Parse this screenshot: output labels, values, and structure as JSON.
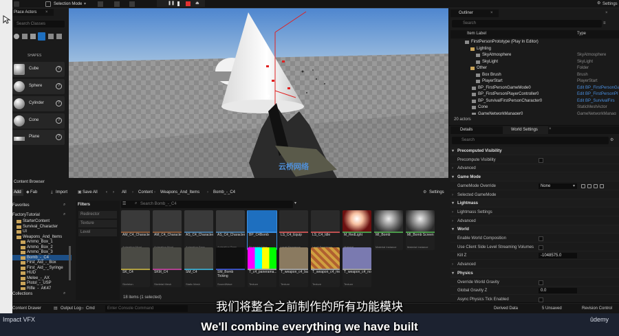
{
  "toolbar": {
    "mode": "Selection Mode",
    "settings": "Settings"
  },
  "place_actors": {
    "tab": "Place Actors",
    "search_placeholder": "Search Classes",
    "category": "SHAPES",
    "shapes": [
      "Cube",
      "Sphere",
      "Cylinder",
      "Cone",
      "Plane"
    ]
  },
  "viewport": {
    "watermark": "云桥网络"
  },
  "outliner": {
    "tab": "Outliner",
    "search_placeholder": "Search",
    "col_label": "Item Label",
    "col_type": "Type",
    "rows": [
      {
        "label": "FirstPersonPrototype (Play In Editor)",
        "type": ""
      },
      {
        "label": "Lighting",
        "type": ""
      },
      {
        "label": "SkyAtmosphere",
        "type": "SkyAtmosphere"
      },
      {
        "label": "SkyLight",
        "type": "SkyLight"
      },
      {
        "label": "Other",
        "type": "Folder"
      },
      {
        "label": "Box Brush",
        "type": "Brush"
      },
      {
        "label": "PlayerStart",
        "type": "PlayerStart"
      },
      {
        "label": "BP_FirstPersonGameMode0",
        "type": "Edit BP_FirstPersonGa"
      },
      {
        "label": "BP_FirstPersonPlayerController0",
        "type": "Edit BP_FirstPersonPl"
      },
      {
        "label": "BP_SurvivalFirstPersonCharacter0",
        "type": "Edit BP_SurvivalFirs"
      },
      {
        "label": "Cone",
        "type": "StaticMeshActor"
      },
      {
        "label": "GameNetworkManager0",
        "type": "GameNetworkManag"
      }
    ],
    "count": "20 actors"
  },
  "details": {
    "tab_details": "Details",
    "tab_world": "World Settings",
    "search_placeholder": "Search",
    "rows": [
      {
        "label": "Precomputed Visibility",
        "kind": "section"
      },
      {
        "label": "Precompute Visibility",
        "kind": "check"
      },
      {
        "label": "Advanced",
        "kind": "sub"
      },
      {
        "label": "Game Mode",
        "kind": "section"
      },
      {
        "label": "GameMode Override",
        "kind": "select",
        "value": "None"
      },
      {
        "label": "Selected GameMode",
        "kind": "sub"
      },
      {
        "label": "Lightmass",
        "kind": "section"
      },
      {
        "label": "Lightmass Settings",
        "kind": "sub"
      },
      {
        "label": "Advanced",
        "kind": "sub"
      },
      {
        "label": "World",
        "kind": "section"
      },
      {
        "label": "Enable World Composition",
        "kind": "check"
      },
      {
        "label": "Use Client Side Level Streaming Volumes",
        "kind": "check"
      },
      {
        "label": "Kill Z",
        "kind": "input",
        "value": "-1048575.0"
      },
      {
        "label": "Advanced",
        "kind": "sub"
      },
      {
        "label": "Physics",
        "kind": "section"
      },
      {
        "label": "Override World Gravity",
        "kind": "check"
      },
      {
        "label": "Global Gravity Z",
        "kind": "input",
        "value": "0.0"
      },
      {
        "label": "Async Physics Tick Enabled",
        "kind": "check"
      }
    ]
  },
  "content": {
    "tab": "Content Browser",
    "add": "Add",
    "fab": "Fab",
    "import": "Import",
    "save_all": "Save All",
    "settings": "Settings",
    "path": [
      "All",
      "Content",
      "Weapons_And_Items",
      "Bomb_-_C4"
    ],
    "favorites": "Favorites",
    "project": "FactoryTutorial",
    "folders": [
      "StarterContent",
      "Survival_Character",
      "UI",
      "Weapons_And_Items",
      "Ammo_Box_1",
      "Ammo_Box_2",
      "Ammo_Box_3",
      "Bomb_-_C4",
      "First_Aid_-_Box",
      "First_Aid_-_Syringe",
      "HUD",
      "Melee_-_AX",
      "Pistol_-_USP",
      "Rifle_-_AK47"
    ],
    "collections": "Collections",
    "filters": "Filters",
    "filter_items": [
      "Redirector",
      "Texture",
      "Level"
    ],
    "search_placeholder": "Search Bomb_-_C4",
    "count": "18 items (1 selected)",
    "assets": [
      {
        "name": "AM_C4_Character_...",
        "type": "Animation Mont..."
      },
      {
        "name": "AM_C4_Character_Idle",
        "type": "Animation Mont..."
      },
      {
        "name": "AS_C4_Character_Equi...",
        "type": "Animation Sequ..."
      },
      {
        "name": "AS_C4_Character_Idle",
        "type": "Animation Sequ..."
      },
      {
        "name": "BP_C4Bomb",
        "type": "Blueprint Class"
      },
      {
        "name": "LS_C4_Equip",
        "type": "Level Sequence"
      },
      {
        "name": "LS_C4_Idle",
        "type": "Level Sequence"
      },
      {
        "name": "M_RedLight",
        "type": "Material"
      },
      {
        "name": "MI_Bomb",
        "type": "Material Instance"
      },
      {
        "name": "MI_Bomb Screen",
        "type": "Material Instance"
      },
      {
        "name": "SK_C4",
        "type": "Skeleton"
      },
      {
        "name": "SKM_C4",
        "type": "Skeletal Mesh"
      },
      {
        "name": "SM_C4",
        "type": "Static Mesh"
      },
      {
        "name": "SM_Bomb Ticking",
        "type": "SoundWave"
      },
      {
        "name": "T_c4_panerama...",
        "type": "Texture"
      },
      {
        "name": "T_weapon_c4_baseCol...",
        "type": "Texture"
      },
      {
        "name": "T_weapon_c4_metallic",
        "type": "Texture"
      },
      {
        "name": "T_weapon_c4_normal",
        "type": "Texture"
      }
    ]
  },
  "statusbar": {
    "drawer": "Content Drawer",
    "output": "Output Log",
    "cmd": "Cmd",
    "console_placeholder": "Enter Console Command",
    "derived": "Derived Data",
    "unsaved": "5 Unsaved",
    "revision": "Revision Control"
  },
  "footer": {
    "title": "Impact VFX",
    "brand": "ûdemy"
  },
  "subtitles": {
    "chinese": "我们将整合之前制作的所有功能模块",
    "english": "We'll combine everything we have built"
  }
}
